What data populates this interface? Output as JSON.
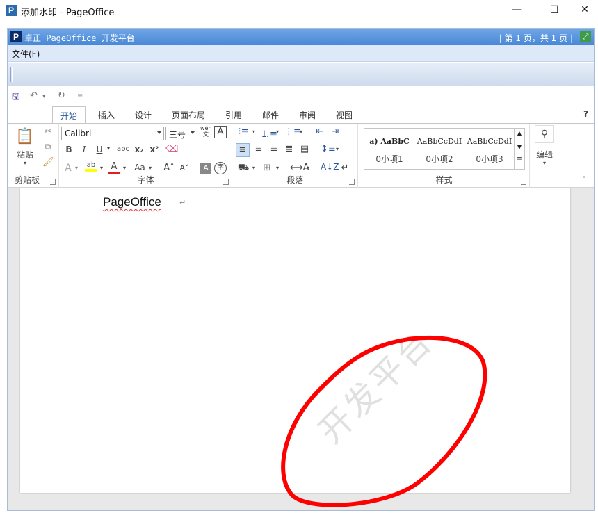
{
  "window": {
    "icon": "P",
    "title": "添加水印 - PageOffice",
    "minimize_glyph": "—",
    "maximize_glyph": "☐",
    "close_glyph": "✕"
  },
  "pageoffice": {
    "logo": "P",
    "brand": "卓正 PageOffice 开发平台",
    "page_info": "| 第 1 页，共 1 页 |",
    "menu_file": "文件(F)"
  },
  "ribbon": {
    "help": "?",
    "tabs": [
      "开始",
      "插入",
      "设计",
      "页面布局",
      "引用",
      "邮件",
      "审阅",
      "视图"
    ],
    "clipboard": {
      "label": "剪贴板",
      "paste": "粘贴"
    },
    "font": {
      "label": "字体",
      "font_name": "Calibri",
      "font_size": "三号",
      "wen": "wén文"
    },
    "paragraph": {
      "label": "段落"
    },
    "styles": {
      "label": "样式",
      "items": [
        {
          "preview": "a)  AaBbC",
          "name": "0小项1"
        },
        {
          "preview": "AaBbCcDdI",
          "name": "0小项2"
        },
        {
          "preview": "AaBbCcDdI",
          "name": "0小项3"
        }
      ]
    },
    "editing": {
      "label": "编辑"
    }
  },
  "document": {
    "text": "PageOffice",
    "para_mark": "↵",
    "watermark": "开发平台"
  },
  "colors": {
    "po_bar": "#4a88d6",
    "tab_active": "#2b579a",
    "annotation_circle": "#ff0000"
  }
}
